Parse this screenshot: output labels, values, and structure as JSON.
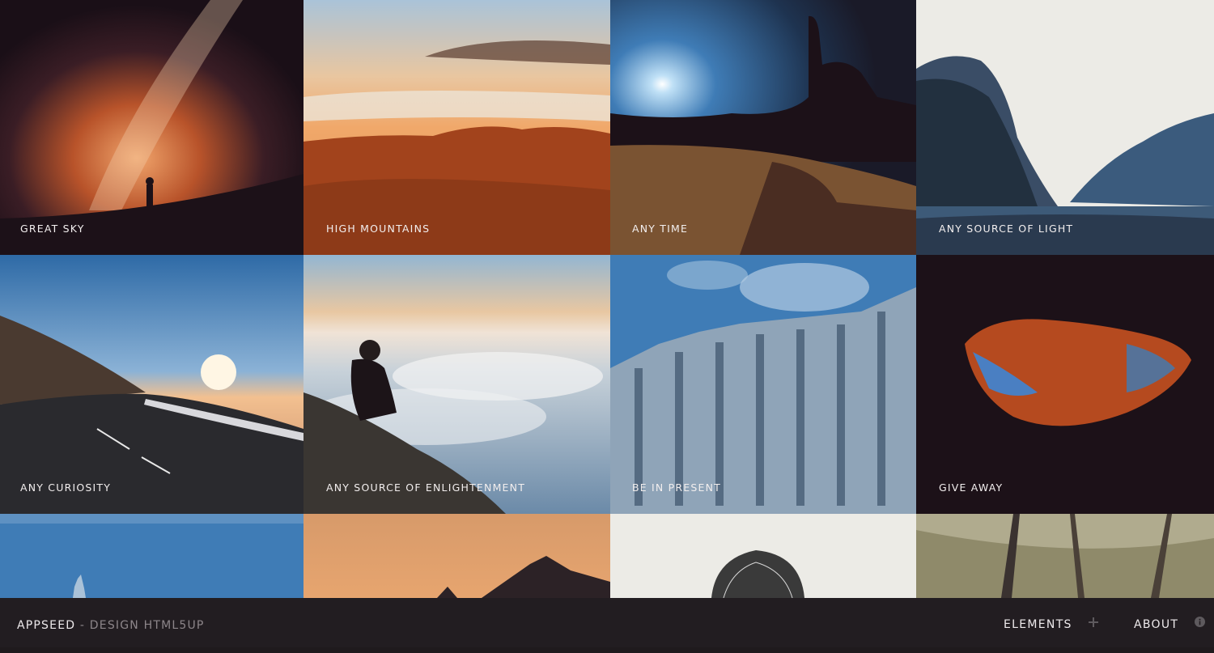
{
  "gallery": {
    "items": [
      {
        "caption": "Great Sky"
      },
      {
        "caption": "High Mountains"
      },
      {
        "caption": "Any Time"
      },
      {
        "caption": "Any Source of Light"
      },
      {
        "caption": "Any Curiosity"
      },
      {
        "caption": "Any Source of Enlightenment"
      },
      {
        "caption": "Be In Present"
      },
      {
        "caption": "Give Away"
      },
      {
        "caption": ""
      },
      {
        "caption": ""
      },
      {
        "caption": ""
      },
      {
        "caption": ""
      }
    ]
  },
  "footer": {
    "brand": "AppSeed",
    "separator": " - ",
    "credit": "Design HTML5UP",
    "nav": [
      {
        "label": "Elements",
        "icon": "plus-icon"
      },
      {
        "label": "About",
        "icon": "info-icon"
      }
    ]
  },
  "colors": {
    "footer_bg": "#221d21",
    "dark_purple": "#1c1118",
    "rust": "#a2431c",
    "sky_blue": "#3f7cb6",
    "peach": "#e7a56f"
  }
}
